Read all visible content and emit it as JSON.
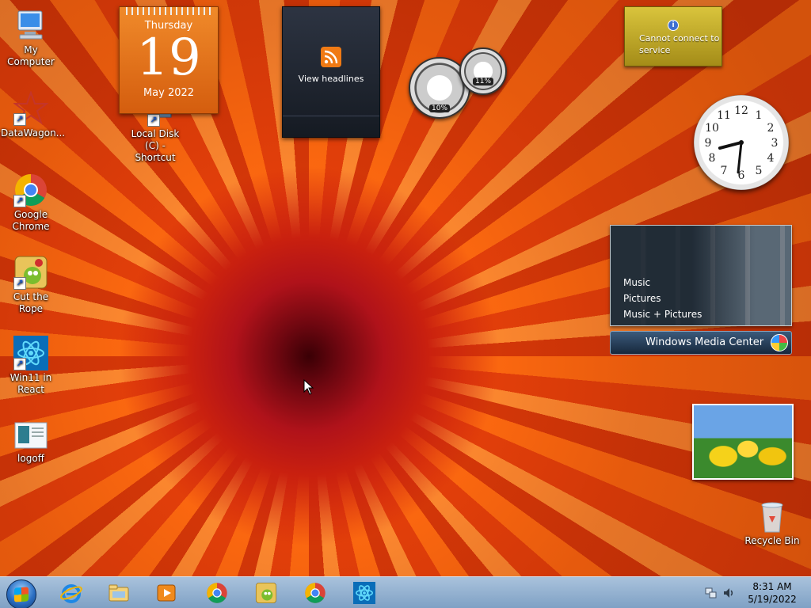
{
  "desktop": {
    "icons": [
      {
        "label": "My Computer"
      },
      {
        "label": "DataWagon..."
      },
      {
        "label": "Local Disk (C) - Shortcut"
      },
      {
        "label": "Google Chrome"
      },
      {
        "label": "Cut the Rope"
      },
      {
        "label": "Win11 in React"
      },
      {
        "label": "logoff"
      },
      {
        "label": "Recycle Bin"
      }
    ]
  },
  "gadgets": {
    "calendar": {
      "day_of_week": "Thursday",
      "day": "19",
      "month_year": "May 2022"
    },
    "feed": {
      "label": "View headlines"
    },
    "cpu_meter": {
      "cpu": "10%",
      "memory": "11%"
    },
    "weather": {
      "message": "Cannot connect to service"
    },
    "clock": {
      "hours": 8,
      "minutes": 31
    },
    "media_center": {
      "items": [
        "Music",
        "Pictures",
        "Music + Pictures"
      ],
      "bar_label": "Windows Media Center"
    }
  },
  "taskbar": {
    "apps": [
      "Internet Explorer",
      "File Explorer",
      "Media Player",
      "Google Chrome",
      "Cut the Rope",
      "Google Chrome",
      "Win11 in React"
    ],
    "time": "8:31 AM",
    "date": "5/19/2022"
  },
  "colors": {
    "calendar": "#e06f17",
    "taskbar": "#9bb8d6",
    "wallpaper": "#e4470c"
  }
}
